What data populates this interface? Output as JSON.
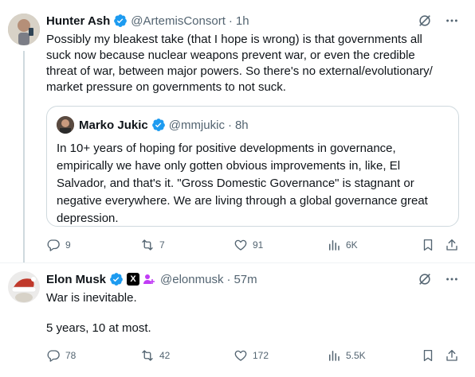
{
  "tweets": [
    {
      "author_name": "Hunter Ash",
      "handle": "@ArtemisConsort",
      "separator": "·",
      "time": "1h",
      "text_lines": [
        "Possibly my bleakest take (that I hope is wrong) is that governments all",
        "suck now because nuclear weapons prevent war, or even the credible",
        "threat of war, between major powers. So there's no external/evolutionary/",
        "market pressure on governments to not suck."
      ],
      "quote": {
        "author_name": "Marko Jukic",
        "handle": "@mmjukic",
        "separator": "·",
        "time": "8h",
        "text_lines": [
          "In 10+ years of hoping for positive developments in governance,",
          "empirically we have only gotten obvious improvements in, like, El",
          "Salvador, and that's it. \"Gross Domestic Governance\" is stagnant or",
          "negative everywhere. We are living through a global governance great",
          "depression."
        ]
      },
      "actions": {
        "replies": "9",
        "reposts": "7",
        "likes": "91",
        "views": "6K"
      }
    },
    {
      "author_name": "Elon Musk",
      "handle": "@elonmusk",
      "separator": "·",
      "time": "57m",
      "badge_x": "X",
      "text_lines": [
        "War is inevitable.",
        "",
        "5 years, 10 at most."
      ],
      "actions": {
        "replies": "78",
        "reposts": "42",
        "likes": "172",
        "views": "5.5K"
      }
    }
  ],
  "icons": {
    "verified": "verified-badge-icon",
    "grok": "grok-icon",
    "more": "more-icon",
    "reply": "reply-icon",
    "repost": "repost-icon",
    "like": "like-icon",
    "views": "views-icon",
    "bookmark": "bookmark-icon",
    "share": "share-icon"
  },
  "colors": {
    "verified": "#1d9bf0",
    "text": "#0f1419",
    "secondary": "#536471",
    "border": "#cfd9de",
    "affiliate": "#c13cf5"
  }
}
